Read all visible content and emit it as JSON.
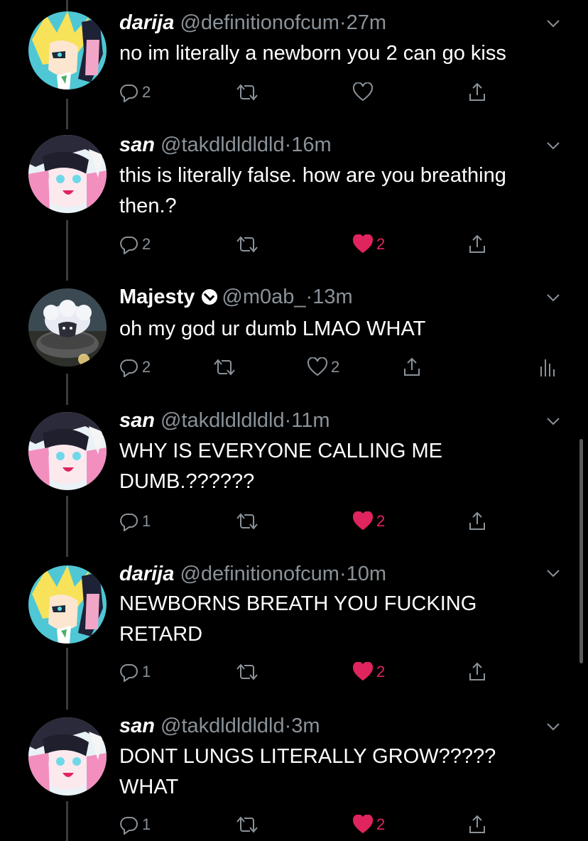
{
  "tweets": [
    {
      "name": "darija",
      "handle": "@definitionofcum",
      "dot": "·",
      "time": "27m",
      "text": "no im literally a newborn you 2 can go kiss",
      "replies": "2",
      "retweets": "",
      "likes": "",
      "liked": false
    },
    {
      "name": "san",
      "handle": "@takdldldldld",
      "dot": "·",
      "time": "16m",
      "text": "this is literally false. how are you breathing then.?",
      "replies": "2",
      "retweets": "",
      "likes": "2",
      "liked": true
    },
    {
      "name": "Majesty",
      "handle": "@m0ab_",
      "dot": "·",
      "time": "13m",
      "text": "oh my god ur dumb LMAO WHAT",
      "replies": "2",
      "retweets": "",
      "likes": "2",
      "liked": false,
      "verified": true
    },
    {
      "name": "san",
      "handle": "@takdldldldld",
      "dot": "·",
      "time": "11m",
      "text": "WHY IS EVERYONE CALLING ME DUMB.??????",
      "replies": "1",
      "retweets": "",
      "likes": "2",
      "liked": true
    },
    {
      "name": "darija",
      "handle": "@definitionofcum",
      "dot": "·",
      "time": "10m",
      "text": "NEWBORNS BREATH YOU FUCKING RETARD",
      "replies": "1",
      "retweets": "",
      "likes": "2",
      "liked": true
    },
    {
      "name": "san",
      "handle": "@takdldldldld",
      "dot": "·",
      "time": "3m",
      "text": "DONT LUNGS LITERALLY GROW????? WHAT",
      "replies": "1",
      "retweets": "",
      "likes": "2",
      "liked": true
    }
  ],
  "icons": {
    "reply": "reply-icon",
    "retweet": "retweet-icon",
    "like": "heart-icon",
    "like_filled": "heart-filled-icon",
    "share": "share-icon",
    "analytics": "analytics-icon",
    "menu": "chevron-down-icon",
    "verified": "verified-badge-icon"
  },
  "colors": {
    "background": "#000000",
    "text": "#ffffff",
    "secondary": "#8a9299",
    "like": "#e0245e",
    "thread_line": "#3b3b3b"
  }
}
